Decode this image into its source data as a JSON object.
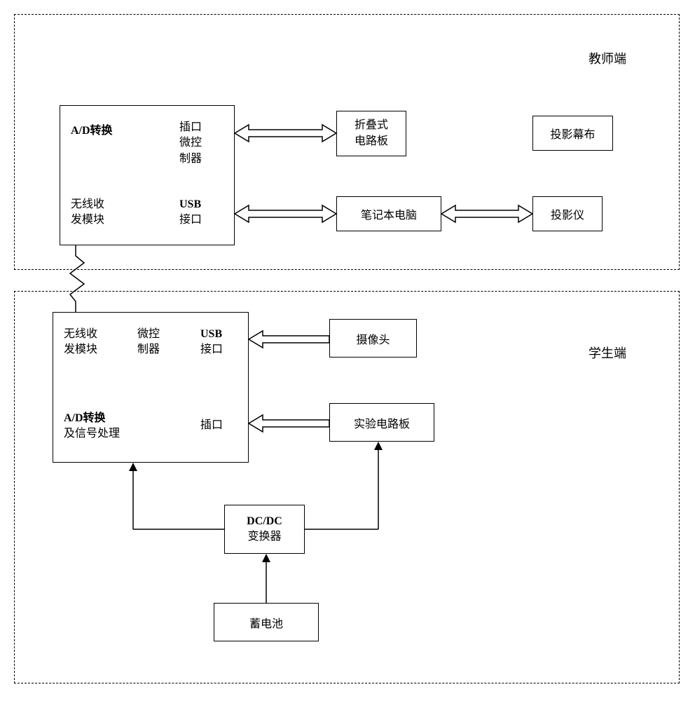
{
  "teacher": {
    "title": "教师端",
    "module": {
      "ad_conv": "A/D转换",
      "port_ctrl_l1": "插口",
      "port_ctrl_l2": "微控",
      "port_ctrl_l3": "制器",
      "wireless_l1": "无线收",
      "wireless_l2": "发模块",
      "usb_l1": "USB",
      "usb_l2": "接口"
    },
    "fold_board_l1": "折叠式",
    "fold_board_l2": "电路板",
    "laptop": "笔记本电脑",
    "screen": "投影幕布",
    "projector": "投影仪"
  },
  "student": {
    "title": "学生端",
    "module": {
      "wireless_l1": "无线收",
      "wireless_l2": "发模块",
      "ctrl_l1": "微控",
      "ctrl_l2": "制器",
      "usb_l1": "USB",
      "usb_l2": "接口",
      "ad_l1": "A/D转换",
      "ad_l2": "及信号处理",
      "port": "插口"
    },
    "camera": "摄像头",
    "exp_board": "实验电路板",
    "dcdc_l1": "DC/DC",
    "dcdc_l2": "变换器",
    "battery": "蓄电池"
  }
}
